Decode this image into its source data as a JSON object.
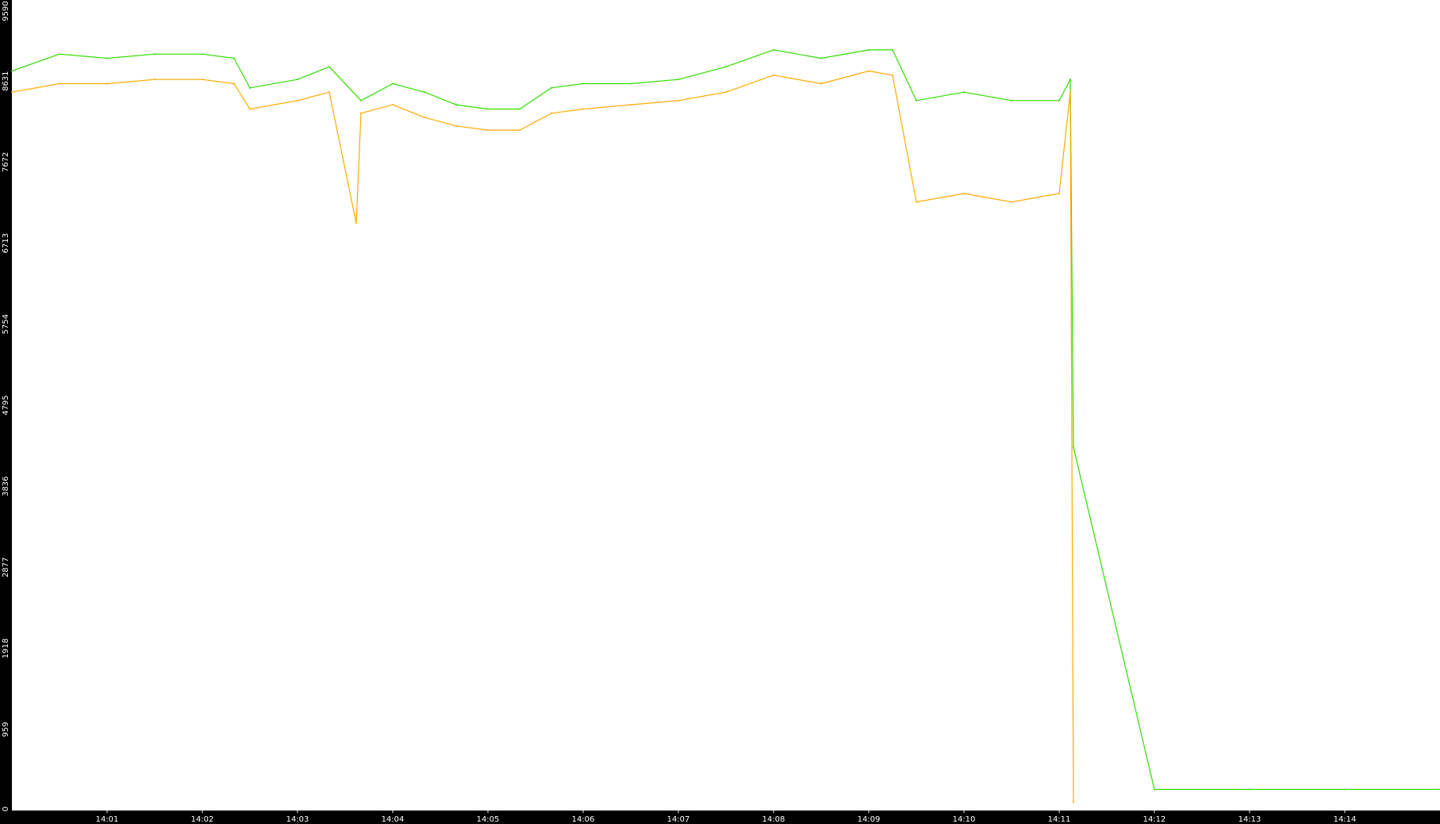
{
  "chart_data": {
    "type": "line",
    "title": "",
    "xlabel": "",
    "ylabel": "",
    "ylim": [
      0,
      9590
    ],
    "y_ticks": [
      "0",
      "959",
      "1918",
      "2877",
      "3836",
      "4795",
      "5754",
      "6713",
      "7672",
      "8631",
      "9590"
    ],
    "x_range": [
      "14:00",
      "14:15"
    ],
    "x_ticks": [
      "14:01",
      "14:02",
      "14:03",
      "14:04",
      "14:05",
      "14:06",
      "14:07",
      "14:08",
      "14:09",
      "14:10",
      "14:11",
      "14:12",
      "14:13",
      "14:14"
    ],
    "grid": false,
    "legend": "none",
    "colors": {
      "background": "#ffffff",
      "axis_band": "#000000",
      "axis_text": "#ffffff",
      "series_green": "#33dd00",
      "series_orange": "#ffaa00"
    },
    "series": [
      {
        "color": "#33dd00",
        "x": [
          "14:00",
          "14:00:30",
          "14:01",
          "14:01:30",
          "14:02",
          "14:02:20",
          "14:02:30",
          "14:03",
          "14:03:20",
          "14:03:40",
          "14:04",
          "14:04:20",
          "14:04:40",
          "14:05",
          "14:05:20",
          "14:05:40",
          "14:06",
          "14:06:30",
          "14:07",
          "14:07:30",
          "14:08",
          "14:08:30",
          "14:09",
          "14:09:15",
          "14:09:30",
          "14:10",
          "14:10:30",
          "14:11",
          "14:11:07",
          "14:11:09",
          "14:12",
          "14:13",
          "14:14",
          "14:15"
        ],
        "y": [
          8750,
          8950,
          8900,
          8950,
          8950,
          8900,
          8550,
          8650,
          8800,
          8400,
          8600,
          8500,
          8350,
          8300,
          8300,
          8550,
          8600,
          8600,
          8650,
          8800,
          9000,
          8900,
          9000,
          9000,
          8400,
          8500,
          8400,
          8400,
          8650,
          4300,
          250,
          250,
          250,
          250
        ]
      },
      {
        "color": "#ffaa00",
        "x": [
          "14:00",
          "14:00:30",
          "14:01",
          "14:01:30",
          "14:02",
          "14:02:20",
          "14:02:30",
          "14:03",
          "14:03:20",
          "14:03:37",
          "14:03:40",
          "14:04",
          "14:04:20",
          "14:04:40",
          "14:05",
          "14:05:20",
          "14:05:40",
          "14:06",
          "14:06:30",
          "14:07",
          "14:07:30",
          "14:08",
          "14:08:30",
          "14:09",
          "14:09:15",
          "14:09:30",
          "14:10",
          "14:10:30",
          "14:11",
          "14:11:07",
          "14:11:09"
        ],
        "y": [
          8500,
          8600,
          8600,
          8650,
          8650,
          8600,
          8300,
          8400,
          8500,
          6950,
          8250,
          8350,
          8200,
          8100,
          8050,
          8050,
          8250,
          8300,
          8350,
          8400,
          8500,
          8700,
          8600,
          8750,
          8700,
          7200,
          7300,
          7200,
          7300,
          8500,
          100
        ]
      }
    ]
  }
}
